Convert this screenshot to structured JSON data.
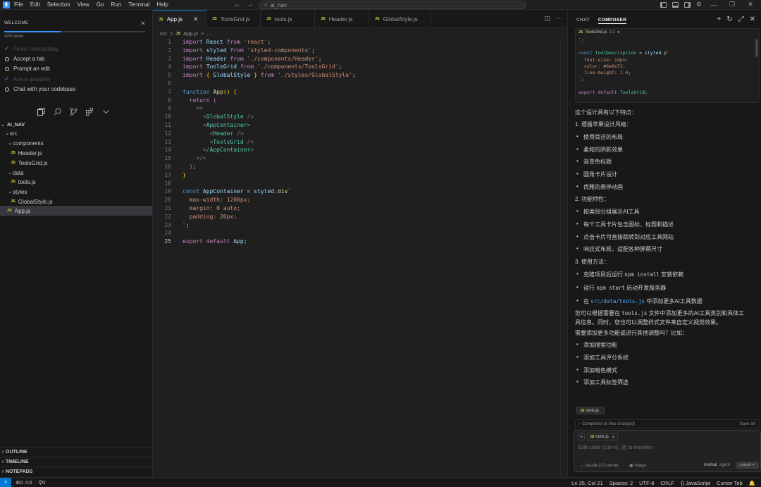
{
  "titlebar": {
    "menu": [
      "File",
      "Edit",
      "Selection",
      "View",
      "Go",
      "Run",
      "Terminal",
      "Help"
    ],
    "search_text": "ai_nav"
  },
  "welcome": {
    "header": "WELCOME",
    "progress_label": "40% done",
    "progress": 0.4,
    "tasks": [
      {
        "label": "Finish onboarding",
        "done": true
      },
      {
        "label": "Accept a tab",
        "done": false
      },
      {
        "label": "Prompt an edit",
        "done": false
      },
      {
        "label": "Ask a question",
        "done": true
      },
      {
        "label": "Chat with your codebase",
        "done": false
      }
    ]
  },
  "explorer": {
    "root": "AI_NAV",
    "items": [
      {
        "label": "src",
        "type": "folder",
        "depth": 0
      },
      {
        "label": "components",
        "type": "folder",
        "depth": 1
      },
      {
        "label": "Header.js",
        "type": "file",
        "depth": 2
      },
      {
        "label": "ToolsGrid.js",
        "type": "file",
        "depth": 2
      },
      {
        "label": "data",
        "type": "folder",
        "depth": 1
      },
      {
        "label": "tools.js",
        "type": "file",
        "depth": 2
      },
      {
        "label": "styles",
        "type": "folder",
        "depth": 1
      },
      {
        "label": "GlobalStyle.js",
        "type": "file",
        "depth": 2
      },
      {
        "label": "App.js",
        "type": "file",
        "depth": 1,
        "selected": true
      }
    ],
    "file_badge": "JS",
    "bottom_sections": [
      "OUTLINE",
      "TIMELINE",
      "NOTEPADS"
    ]
  },
  "editor": {
    "tabs": [
      {
        "label": "App.js",
        "active": true
      },
      {
        "label": "ToolsGrid.js",
        "active": false
      },
      {
        "label": "tools.js",
        "active": false
      },
      {
        "label": "Header.js",
        "active": false
      },
      {
        "label": "GlobalStyle.js",
        "active": false
      }
    ],
    "breadcrumb": [
      "src",
      ">",
      "App.js",
      ">",
      "..."
    ],
    "current_line": 25,
    "line_count": 25
  },
  "composer": {
    "tabs": [
      "CHAT",
      "COMPOSER"
    ],
    "card_file": "ToolsGrid.js",
    "card_meta": "1/1",
    "card_code": [
      "`;",
      "",
      "const ToolDescription = styled.p`",
      "  font-size: 14px;",
      "  color: #6e6e73;",
      "  line-height: 1.4;",
      "`;",
      "",
      "export default ToolsGrid;"
    ],
    "response": {
      "intro": "这个设计具有以下特点：",
      "s1": "1. 遵循苹果设计风格：",
      "s1_items": [
        "使用简洁的布局",
        "柔和的阴影效果",
        "渐变色标题",
        "圆角卡片设计",
        "优雅的悬停动画"
      ],
      "s2": "2. 功能特性：",
      "s2_items": [
        "按类别分组展示AI工具",
        "每个工具卡片包含图标、标题和描述",
        "点击卡片可直接跳转到对应工具网站",
        "响应式布局，适配各种屏幕尺寸"
      ],
      "s3": "3. 使用方法：",
      "u1_a": "克隆项目后运行",
      "u1_code": "npm install",
      "u1_b": "安装依赖",
      "u2_a": "运行",
      "u2_code": "npm start",
      "u2_b": "启动开发服务器",
      "u3_a": "在",
      "u3_code": "src/data/tools.js",
      "u3_b": "中添加更多AI工具数据",
      "para1_a": "您可以根据需要在",
      "para1_code": "tools.js",
      "para1_b": "文件中添加更多的AI工具类别和具体工",
      "para1_c": "具信息。同时，您也可以调整样式文件来自定义视觉效果。",
      "para2": "需要添加更多功能或进行其他调整吗？比如：",
      "s4_items": [
        "添加搜索功能",
        "添加工具评分系统",
        "添加暗色模式",
        "添加工具标签筛选"
      ]
    },
    "context_chip": "tools.js",
    "completed": "Completed (5 files changed)",
    "save_all": "Save all",
    "input_chip": "tools.js",
    "placeholder": "Edit code (Ctrl+I), @ to mention",
    "model": "claude-3.5-sonnet",
    "image": "image",
    "mode_normal": "normal",
    "mode_agent": "agent",
    "submit": "submit ↵"
  },
  "status": {
    "errors": "0",
    "warnings": "0",
    "ports": "0",
    "position": "Ln 25, Col 21",
    "spaces": "Spaces: 2",
    "encoding": "UTF-8",
    "eol": "CRLF",
    "language": "JavaScript",
    "cursor_tab": "Cursor Tab"
  }
}
